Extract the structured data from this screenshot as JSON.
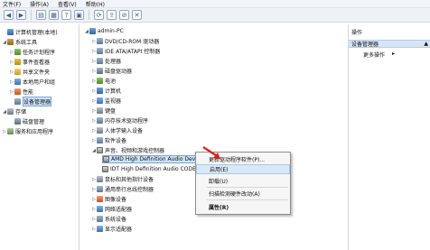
{
  "menubar": [
    "文件(F)",
    "操作(A)",
    "查看(V)",
    "帮助(H)"
  ],
  "toolbar": [
    "back-icon",
    "forward-icon",
    "up-icon",
    "properties-icon",
    "help-icon",
    "show-icon",
    "scan-icon",
    "update-icon",
    "disable-icon",
    "uninstall-icon"
  ],
  "left_tree": [
    {
      "label": "计算机管理(本地)",
      "icon": "computer-icon",
      "exp": ""
    },
    {
      "label": "系统工具",
      "icon": "tools-icon",
      "exp": "◢"
    },
    {
      "label": "任务计划程序",
      "icon": "scheduler-icon",
      "exp": "▷"
    },
    {
      "label": "事件查看器",
      "icon": "event-viewer-icon",
      "exp": "▷"
    },
    {
      "label": "共享文件夹",
      "icon": "shared-folder-icon",
      "exp": "▷"
    },
    {
      "label": "本地用户和组",
      "icon": "users-icon",
      "exp": "▷"
    },
    {
      "label": "性能",
      "icon": "performance-icon",
      "exp": "▷"
    },
    {
      "label": "设备管理器",
      "icon": "device-manager-icon",
      "exp": ""
    },
    {
      "label": "存储",
      "icon": "storage-icon",
      "exp": "◢"
    },
    {
      "label": "磁盘管理",
      "icon": "disk-icon",
      "exp": ""
    },
    {
      "label": "服务和应用程序",
      "icon": "services-icon",
      "exp": "▷"
    }
  ],
  "device_tree": [
    {
      "label": "admin-PC",
      "exp": "◢"
    },
    {
      "label": "DVD/CD-ROM 驱动器",
      "exp": "▷"
    },
    {
      "label": "IDE ATA/ATAPI 控制器",
      "exp": "▷"
    },
    {
      "label": "处理器",
      "exp": "▷"
    },
    {
      "label": "磁盘驱动器",
      "exp": "▷"
    },
    {
      "label": "电池",
      "exp": "▷"
    },
    {
      "label": "计算机",
      "exp": "▷"
    },
    {
      "label": "监视器",
      "exp": "▷"
    },
    {
      "label": "键盘",
      "exp": "▷"
    },
    {
      "label": "内存技术驱动程序",
      "exp": "▷"
    },
    {
      "label": "人体学输入设备",
      "exp": "▷"
    },
    {
      "label": "软件设备",
      "exp": "▷"
    },
    {
      "label": "声音、视频和游戏控制器",
      "exp": "◢"
    },
    {
      "label": "AMD High Definition Audio Device",
      "exp": ""
    },
    {
      "label": "IDT High Definition Audio CODEC",
      "exp": ""
    },
    {
      "label": "鼠标和其他指针设备",
      "exp": "▷"
    },
    {
      "label": "通用串行总线控制器",
      "exp": "▷"
    },
    {
      "label": "图像设备",
      "exp": "▷"
    },
    {
      "label": "网络适配器",
      "exp": "▷"
    },
    {
      "label": "系统设备",
      "exp": "▷"
    },
    {
      "label": "显示适配器",
      "exp": "▷"
    }
  ],
  "right_pane": {
    "header": "操作",
    "selected": "设备管理器",
    "more": "更多操作"
  },
  "context_menu": [
    "更新驱动程序软件(P)...",
    "启用(E)",
    "卸载(U)",
    "扫描检测硬件改动(A)",
    "属性(R)"
  ],
  "colors": {
    "selection": "#cde4fb",
    "arrow": "#e02020"
  }
}
